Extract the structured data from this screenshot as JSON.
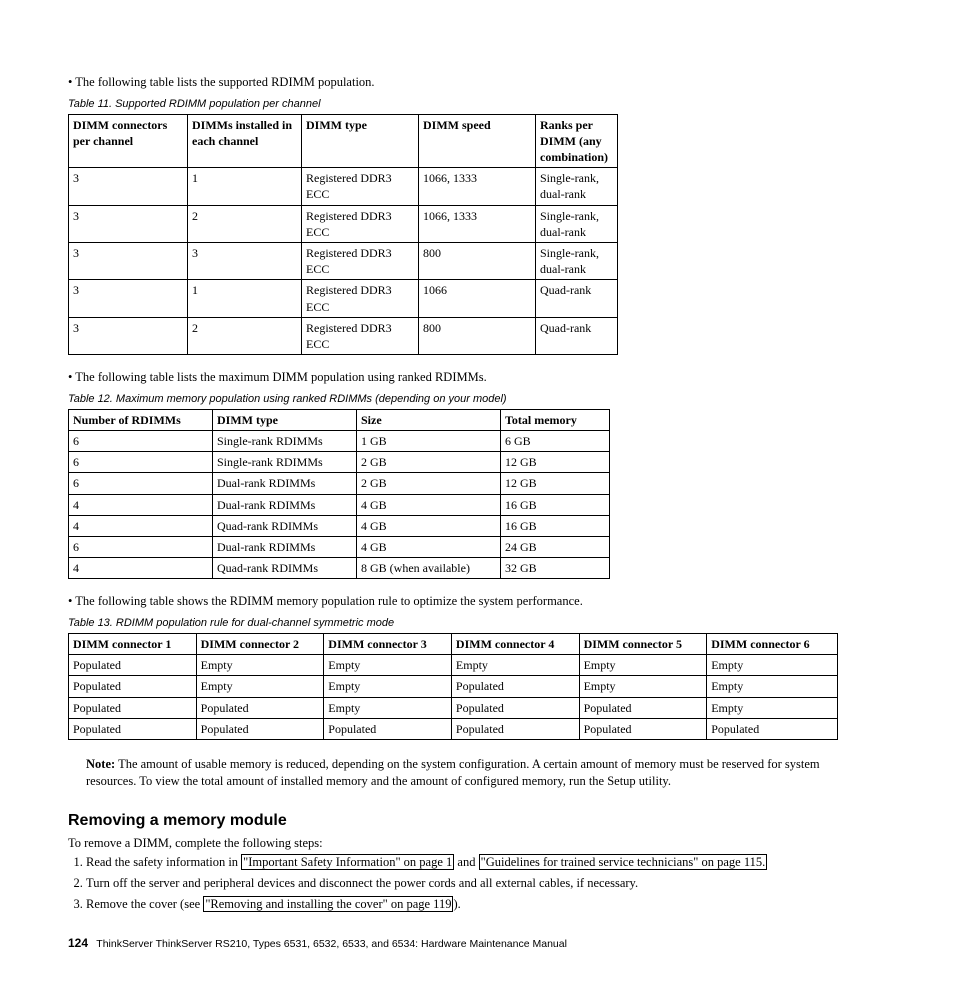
{
  "bullet1": "The following table lists the supported RDIMM population.",
  "table11": {
    "caption": "Table 11. Supported RDIMM population per channel",
    "headers": [
      "DIMM connectors per channel",
      "DIMMs installed in each channel",
      "DIMM type",
      "DIMM speed",
      "Ranks per DIMM (any combination)"
    ],
    "rows": [
      [
        "3",
        "1",
        "Registered DDR3 ECC",
        "1066, 1333",
        "Single-rank, dual-rank"
      ],
      [
        "3",
        "2",
        "Registered DDR3 ECC",
        "1066, 1333",
        "Single-rank, dual-rank"
      ],
      [
        "3",
        "3",
        "Registered DDR3 ECC",
        "800",
        "Single-rank, dual-rank"
      ],
      [
        "3",
        "1",
        "Registered DDR3 ECC",
        "1066",
        "Quad-rank"
      ],
      [
        "3",
        "2",
        "Registered DDR3 ECC",
        "800",
        "Quad-rank"
      ]
    ]
  },
  "bullet2": "The following table lists the maximum DIMM population using ranked RDIMMs.",
  "table12": {
    "caption": "Table 12. Maximum memory population using ranked RDIMMs (depending on your model)",
    "headers": [
      "Number of RDIMMs",
      "DIMM type",
      "Size",
      "Total memory"
    ],
    "rows": [
      [
        "6",
        "Single-rank RDIMMs",
        "1 GB",
        "6 GB"
      ],
      [
        "6",
        "Single-rank RDIMMs",
        "2 GB",
        "12 GB"
      ],
      [
        "6",
        "Dual-rank RDIMMs",
        "2 GB",
        "12 GB"
      ],
      [
        "4",
        "Dual-rank RDIMMs",
        "4 GB",
        "16 GB"
      ],
      [
        "4",
        "Quad-rank RDIMMs",
        "4 GB",
        "16 GB"
      ],
      [
        "6",
        "Dual-rank RDIMMs",
        "4 GB",
        "24 GB"
      ],
      [
        "4",
        "Quad-rank RDIMMs",
        "8 GB (when available)",
        "32 GB"
      ]
    ]
  },
  "bullet3": "The following table shows the RDIMM memory population rule to optimize the system performance.",
  "table13": {
    "caption": "Table 13. RDIMM population rule for dual-channel symmetric mode",
    "headers": [
      "DIMM connector 1",
      "DIMM connector 2",
      "DIMM connector 3",
      "DIMM connector 4",
      "DIMM connector 5",
      "DIMM connector 6"
    ],
    "rows": [
      [
        "Populated",
        "Empty",
        "Empty",
        "Empty",
        "Empty",
        "Empty"
      ],
      [
        "Populated",
        "Empty",
        "Empty",
        "Populated",
        "Empty",
        "Empty"
      ],
      [
        "Populated",
        "Populated",
        "Empty",
        "Populated",
        "Populated",
        "Empty"
      ],
      [
        "Populated",
        "Populated",
        "Populated",
        "Populated",
        "Populated",
        "Populated"
      ]
    ]
  },
  "note": {
    "label": "Note:",
    "text": "The amount of usable memory is reduced, depending on the system configuration. A certain amount of memory must be reserved for system resources. To view the total amount of installed memory and the amount of configured memory, run the Setup utility."
  },
  "section_heading": "Removing a memory module",
  "section_intro": "To remove a DIMM, complete the following steps:",
  "steps": {
    "s1a": "Read the safety information in ",
    "s1link1": "\"Important Safety Information\" on page 1",
    "s1b": " and ",
    "s1link2": "\"Guidelines for trained service technicians\" on page 115.",
    "s2": "Turn off the server and peripheral devices and disconnect the power cords and all external cables, if necessary.",
    "s3a": "Remove the cover (see ",
    "s3link": "\"Removing and installing the cover\" on page 119",
    "s3b": ")."
  },
  "footer": {
    "page": "124",
    "text": "ThinkServer ThinkServer RS210, Types 6531, 6532, 6533, and 6534: Hardware Maintenance Manual"
  }
}
